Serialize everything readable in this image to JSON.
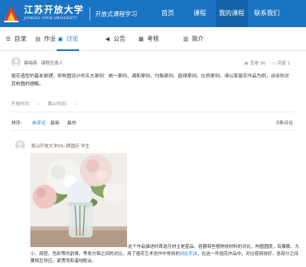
{
  "header": {
    "school_name": "江苏开放大学",
    "school_name_en": "JIANGSU OPEN UNIVERSITY",
    "subtitle": "开放式课程学习",
    "nav": [
      {
        "label": "首页"
      },
      {
        "label": "课程"
      },
      {
        "label": "我的课程",
        "active": true
      },
      {
        "label": "联系我们"
      }
    ],
    "colors": {
      "brand": "#1a73c3",
      "nav_active": "#1462a8"
    }
  },
  "tabs": [
    {
      "label": "目录",
      "icon": "list-icon"
    },
    {
      "label": "作业",
      "icon": "assignment-icon"
    },
    {
      "label": "讨论",
      "icon": "discussion-icon",
      "active": true
    },
    {
      "label": "公告",
      "icon": "megaphone-icon"
    },
    {
      "label": "考核",
      "icon": "exam-icon"
    },
    {
      "label": "简介",
      "icon": "info-icon"
    }
  ],
  "topic": {
    "author": "蔡梅燕",
    "role": "课程负责人",
    "views": "查看 90",
    "replies": "回复 1",
    "body": "插花造型的基本原理，即构图设计的五大原则：统一原则、调和原则、均衡原则、韵律原则、比例原则。请以某插花作品为例，谈谈你对其构图的理解。",
    "start_label": "开始时间：",
    "start_value": "-",
    "end_label": "截止时间：",
    "end_value": "-"
  },
  "sort": {
    "label": "排序:",
    "options": [
      {
        "label": "未评论",
        "active": true
      },
      {
        "label": "最新"
      },
      {
        "label": "最热"
      }
    ],
    "reply_count": "0条评论"
  },
  "reply": {
    "author": "昆山开放大学09--顾国庆",
    "role": "学生",
    "text_before": "这个作品描述时首选可材主是蓝品、容器带些植物技材料的对比，构图圆度，有聚散、大小、疏密、色彩等的韵律、等条方面之间的对比，用了插花艺术创作中常用的",
    "text_link": "对比手法",
    "text_after": "，在这一件插花作品中，对比使用较好，各部分之间要相互呼应，紧贯而和谐地配合。"
  }
}
